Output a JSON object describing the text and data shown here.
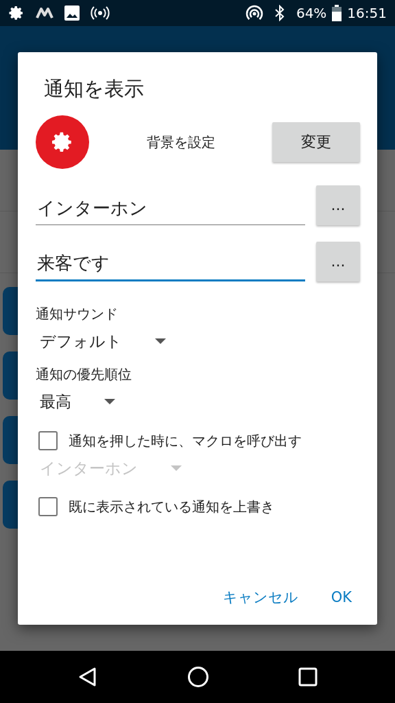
{
  "status_bar": {
    "battery": "64%",
    "time": "16:51"
  },
  "dialog": {
    "title": "通知を表示",
    "background_row": {
      "label": "背景を設定",
      "button": "変更"
    },
    "fields": [
      {
        "value": "インターホン",
        "focused": false,
        "button": "..."
      },
      {
        "value": "来客です",
        "focused": true,
        "button": "..."
      }
    ],
    "settings": [
      {
        "kind": "label",
        "text": "通知サウンド"
      },
      {
        "kind": "select",
        "value": "デフォルト",
        "disabled": false
      },
      {
        "kind": "label",
        "text": "通知の優先順位"
      },
      {
        "kind": "select",
        "value": "最高",
        "disabled": false
      },
      {
        "kind": "checkbox",
        "text": "通知を押した時に、マクロを呼び出す",
        "checked": false
      },
      {
        "kind": "select",
        "value": "インターホン",
        "disabled": true
      },
      {
        "kind": "checkbox",
        "text": "既に表示されている通知を上書き",
        "checked": false
      }
    ],
    "buttons": [
      {
        "label": "キャンセル"
      },
      {
        "label": "OK"
      }
    ]
  }
}
